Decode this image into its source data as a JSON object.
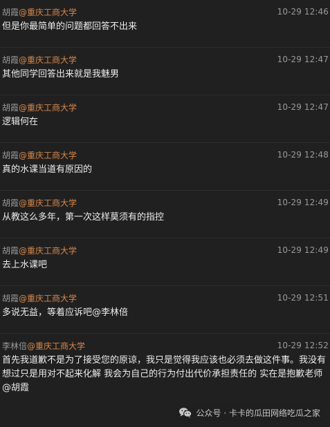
{
  "messages": [
    {
      "user": "胡霞",
      "org": "@重庆工商大学",
      "time": "10-29 12:46",
      "text": "但是你最简单的问题都回答不出来"
    },
    {
      "user": "胡霞",
      "org": "@重庆工商大学",
      "time": "10-29 12:47",
      "text": "其他同学回答出来就是我魅男"
    },
    {
      "user": "胡霞",
      "org": "@重庆工商大学",
      "time": "10-29 12:47",
      "text": "逻辑何在"
    },
    {
      "user": "胡霞",
      "org": "@重庆工商大学",
      "time": "10-29 12:48",
      "text": "真的水课当道有原因的"
    },
    {
      "user": "胡霞",
      "org": "@重庆工商大学",
      "time": "10-29 12:49",
      "text": "从教这么多年，第一次这样莫须有的指控"
    },
    {
      "user": "胡霞",
      "org": "@重庆工商大学",
      "time": "10-29 12:49",
      "text": "去上水课吧"
    },
    {
      "user": "胡霞",
      "org": "@重庆工商大学",
      "time": "10-29 12:51",
      "text": "多说无益，等着应诉吧@李林倍"
    },
    {
      "user": "李林倍",
      "org": "@重庆工商大学",
      "time": "10-29 12:52",
      "text": "首先我道歉不是为了接受您的原谅，我只是觉得我应该也必须去做这件事。我没有想过只是用对不起来化解 我会为自己的行为付出代价承担责任的 实在是抱歉老师@胡霞"
    }
  ],
  "watermark": {
    "text": "公众号 · 卡卡的瓜田网络吃瓜之家",
    "icon": "wechat-icon"
  },
  "colors": {
    "background": "#202020",
    "org_accent": "#d9874a",
    "meta_text": "#9a9a9a",
    "body_text": "#ececec",
    "divider": "#2e2e2e"
  }
}
